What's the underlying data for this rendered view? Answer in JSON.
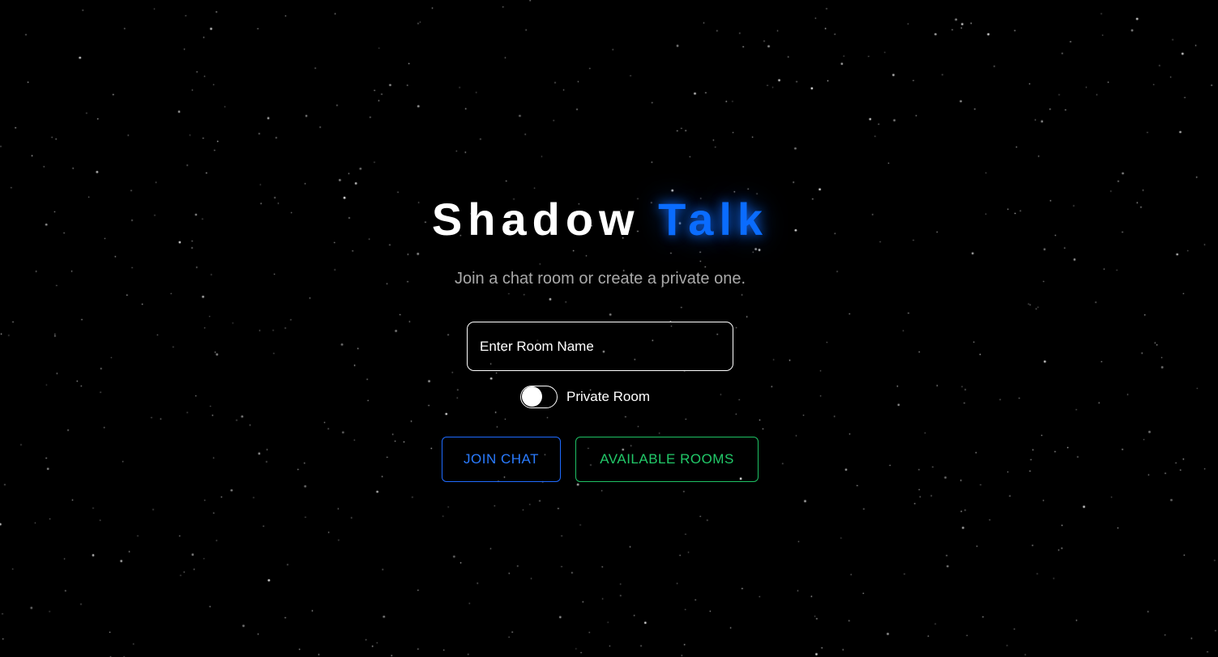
{
  "app": {
    "title_main": "Shadow",
    "title_accent": "Talk",
    "subtitle": "Join a chat room or create a private one."
  },
  "form": {
    "room_input_placeholder": "Enter Room Name",
    "room_input_value": "",
    "private_toggle_label": "Private Room",
    "private_toggle_on": false
  },
  "actions": {
    "join_label": "JOIN CHAT",
    "rooms_label": "AVAILABLE ROOMS"
  },
  "colors": {
    "background": "#000000",
    "accent_blue": "#0a6cff",
    "accent_green": "#22c969",
    "subtitle_gray": "#a9a9a9"
  }
}
